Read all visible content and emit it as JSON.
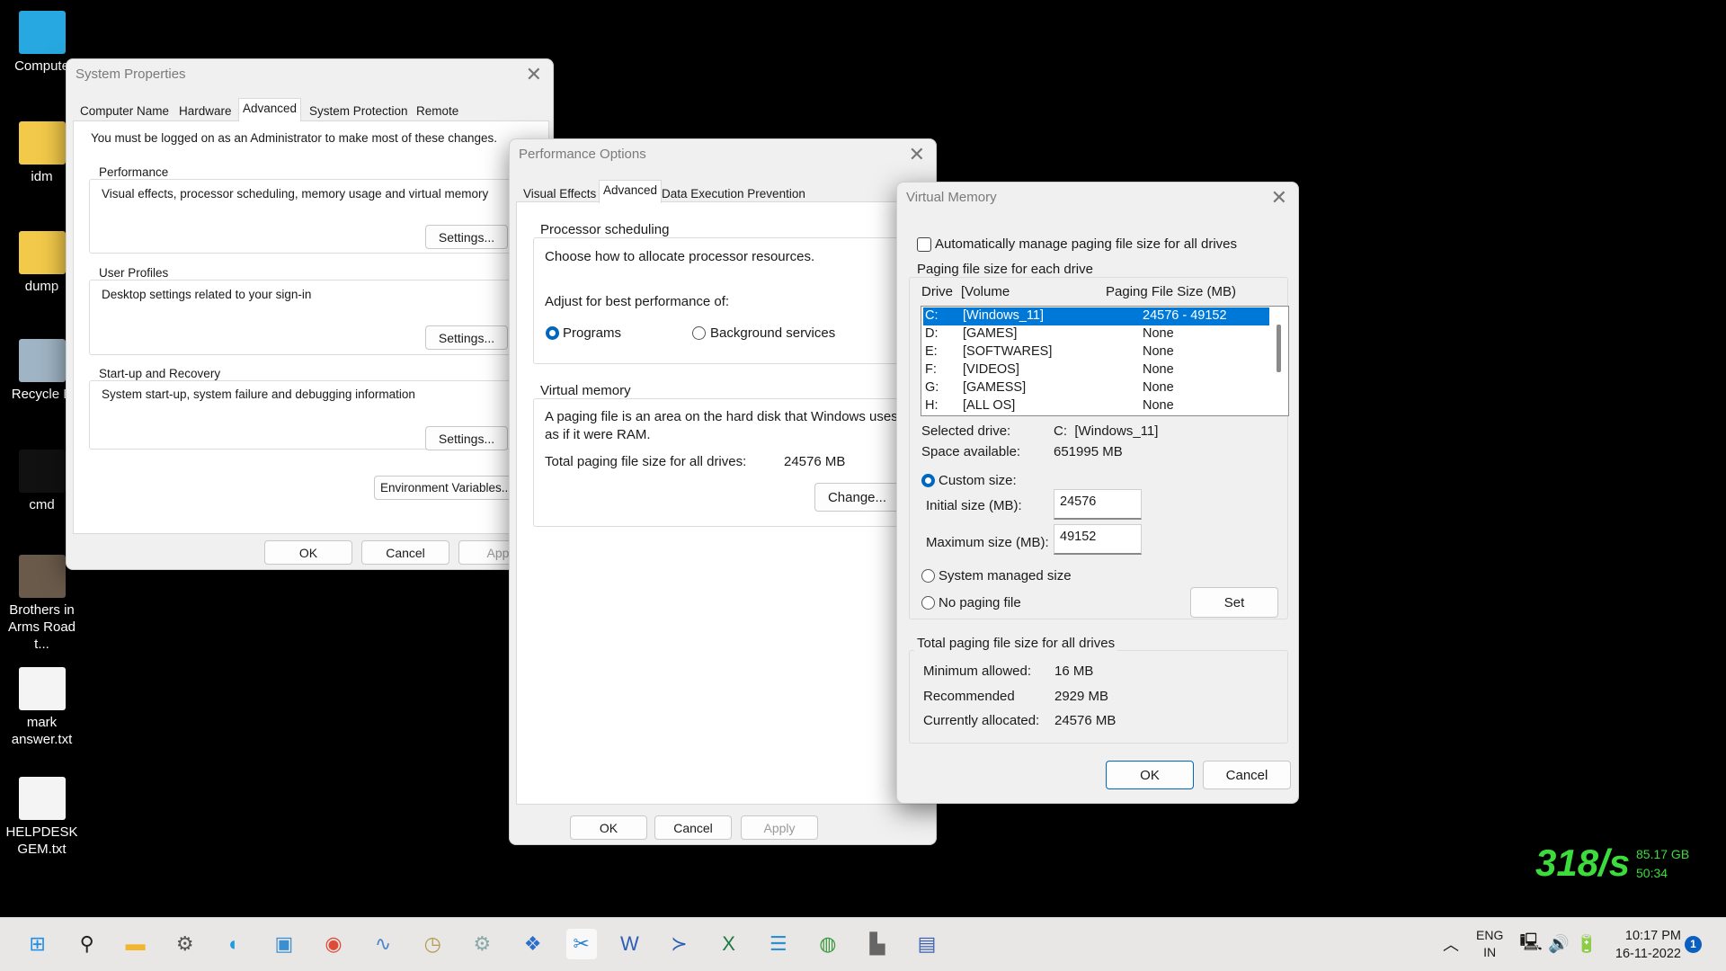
{
  "desktop": [
    {
      "label": "Compute",
      "icon": "monitor-icon",
      "color": "#28a8e0"
    },
    {
      "label": "idm",
      "icon": "folder-icon",
      "color": "#f3c94a"
    },
    {
      "label": "dump",
      "icon": "folder-icon",
      "color": "#f3c94a"
    },
    {
      "label": "Recycle B",
      "icon": "recycle-bin-icon",
      "color": "#9fb4c4"
    },
    {
      "label": "cmd",
      "icon": "cmd-icon",
      "color": "#111"
    },
    {
      "label": "Brothers in Arms Road t...",
      "icon": "game-icon",
      "color": "#6a5a4a"
    },
    {
      "label": "mark answer.txt",
      "icon": "text-file-icon",
      "color": "#f4f4f4"
    },
    {
      "label": "HELPDESK GEM.txt",
      "icon": "text-file-icon",
      "color": "#f4f4f4"
    }
  ],
  "system_properties": {
    "title": "System Properties",
    "tabs": [
      "Computer Name",
      "Hardware",
      "Advanced",
      "System Protection",
      "Remote"
    ],
    "admin_note": "You must be logged on as an Administrator to make most of these changes.",
    "performance": {
      "label": "Performance",
      "desc": "Visual effects, processor scheduling, memory usage and virtual memory",
      "button": "Settings..."
    },
    "user_profiles": {
      "label": "User Profiles",
      "desc": "Desktop settings related to your sign-in",
      "button": "Settings..."
    },
    "startup": {
      "label": "Start-up and Recovery",
      "desc": "System start-up, system failure and debugging information",
      "button": "Settings..."
    },
    "env_button": "Environment Variables...",
    "ok": "OK",
    "cancel": "Cancel",
    "apply": "Apply"
  },
  "performance_options": {
    "title": "Performance Options",
    "tabs": [
      "Visual Effects",
      "Advanced",
      "Data Execution Prevention"
    ],
    "proc_group": "Processor scheduling",
    "proc_desc": "Choose how to allocate processor resources.",
    "adjust": "Adjust for best performance of:",
    "programs": "Programs",
    "background": "Background services",
    "vm_group": "Virtual memory",
    "vm_desc1": "A paging file is an area on the hard disk that Windows uses",
    "vm_desc2": "as if it were RAM.",
    "total_label": "Total paging file size for all drives:",
    "total_value": "24576 MB",
    "change": "Change...",
    "ok": "OK",
    "cancel": "Cancel",
    "apply": "Apply"
  },
  "virtual_memory": {
    "title": "Virtual Memory",
    "auto_manage": "Automatically manage paging file size for all drives",
    "auto_manage_checked": false,
    "group": "Paging file size for each drive",
    "headers": {
      "drive": "Drive",
      "volume": "[Volume",
      "size": "Paging File Size (MB)"
    },
    "drives": [
      {
        "drive": "C:",
        "volume": "[Windows_11]",
        "size": "24576 - 49152"
      },
      {
        "drive": "D:",
        "volume": "[GAMES]",
        "size": "None"
      },
      {
        "drive": "E:",
        "volume": "[SOFTWARES]",
        "size": "None"
      },
      {
        "drive": "F:",
        "volume": "[VIDEOS]",
        "size": "None"
      },
      {
        "drive": "G:",
        "volume": "[GAMESS]",
        "size": "None"
      },
      {
        "drive": "H:",
        "volume": "[ALL OS]",
        "size": "None"
      }
    ],
    "selected_label": "Selected drive:",
    "selected_value": "C:  [Windows_11]",
    "space_label": "Space available:",
    "space_value": "651995 MB",
    "custom": "Custom size:",
    "initial_label": "Initial size (MB):",
    "initial_value": "24576",
    "max_label": "Maximum size (MB):",
    "max_value": "49152",
    "system_managed": "System managed size",
    "no_paging": "No paging file",
    "set": "Set",
    "total_group": "Total paging file size for all drives",
    "min_label": "Minimum allowed:",
    "min_value": "16 MB",
    "rec_label": "Recommended",
    "rec_value": "2929 MB",
    "cur_label": "Currently allocated:",
    "cur_value": "24576 MB",
    "ok": "OK",
    "cancel": "Cancel"
  },
  "widget": {
    "speed": "318/s",
    "size": "85.17 GB",
    "time": "50:34",
    "color": "#3ddc3d"
  },
  "taskbar": {
    "apps": [
      {
        "icon": "windows-start-icon",
        "glyph": "⊞",
        "color": "#1e8fe6"
      },
      {
        "icon": "search-icon",
        "glyph": "⚲",
        "color": "#222"
      },
      {
        "icon": "file-explorer-icon",
        "glyph": "▬",
        "color": "#f2b530"
      },
      {
        "icon": "settings-icon",
        "glyph": "⚙",
        "color": "#555"
      },
      {
        "icon": "edge-icon",
        "glyph": "◐",
        "color": "#1f9be0"
      },
      {
        "icon": "control-panel-icon",
        "glyph": "▣",
        "color": "#3a8fd0"
      },
      {
        "icon": "chrome-icon",
        "glyph": "◉",
        "color": "#de4b37"
      },
      {
        "icon": "resource-monitor-icon",
        "glyph": "∿",
        "color": "#4a86c8"
      },
      {
        "icon": "clock-icon",
        "glyph": "◷",
        "color": "#b59a4d"
      },
      {
        "icon": "services-icon",
        "glyph": "⚙",
        "color": "#8aa"
      },
      {
        "icon": "app-icon",
        "glyph": "❖",
        "color": "#2a6fc9"
      },
      {
        "icon": "snipping-tool-icon",
        "glyph": "✂",
        "color": "#2a7fd0"
      },
      {
        "icon": "word-icon",
        "glyph": "W",
        "color": "#2b5fb8"
      },
      {
        "icon": "powershell-icon",
        "glyph": "≻",
        "color": "#2a5fb0"
      },
      {
        "icon": "excel-icon",
        "glyph": "X",
        "color": "#1e7a43"
      },
      {
        "icon": "notepad-icon",
        "glyph": "☰",
        "color": "#2a90d0"
      },
      {
        "icon": "idm-icon",
        "glyph": "◍",
        "color": "#3c9a3c"
      },
      {
        "icon": "device-icon",
        "glyph": "▙",
        "color": "#666"
      },
      {
        "icon": "remote-desktop-icon",
        "glyph": "▤",
        "color": "#3a62b0"
      }
    ],
    "lang": "ENG",
    "region": "IN",
    "time": "10:17 PM",
    "date": "16-11-2022",
    "notifications": "1"
  }
}
